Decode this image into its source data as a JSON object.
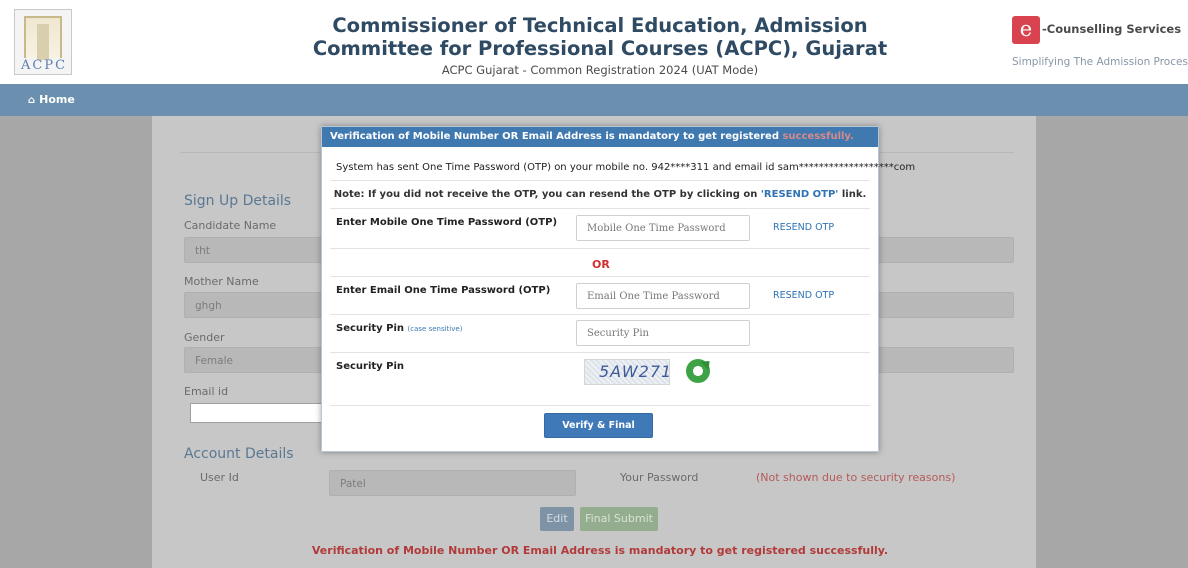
{
  "header": {
    "logo_text": "ACPC",
    "title_line1": "Commissioner of Technical Education, Admission",
    "title_line2": "Committee for Professional Courses (ACPC), Gujarat",
    "subtitle": "ACPC Gujarat - Common Registration 2024 (UAT Mode)",
    "ec_badge": "e",
    "ec_title": "-Counselling Services",
    "ec_tagline": "Simplifying The Admission Process"
  },
  "nav": {
    "home_label": "Home"
  },
  "form": {
    "signup_title": "Sign Up Details",
    "candidate_name_label": "Candidate Name",
    "candidate_name_value": "tht",
    "mother_name_label": "Mother Name",
    "mother_name_value": "ghgh",
    "gender_label": "Gender",
    "gender_value": "Female",
    "email_label": "Email id",
    "account_title": "Account Details",
    "user_id_label": "User Id",
    "user_id_value": "Patel",
    "password_label": "Your Password",
    "password_note": "(Not shown due to security reasons)",
    "edit_label": "Edit",
    "final_submit_label": "Final Submit",
    "bottom_warning": "Verification of Mobile Number OR Email Address is mandatory to get registered successfully."
  },
  "modal": {
    "header_text": "Verification of Mobile Number OR Email Address is mandatory to get registered ",
    "header_text_faded": "successfully.",
    "otp_sent_text": "System has sent One Time Password (OTP) on your mobile no. 942****311 and email id sam*******************com",
    "note_prefix": "Note: If you did not receive the OTP,    you can resend the OTP by clicking on ",
    "note_link": "'RESEND OTP'",
    "note_suffix": " link.",
    "mobile_otp_label": "Enter Mobile One Time Password (OTP)",
    "mobile_otp_placeholder": "Mobile One Time Password",
    "resend_label": "RESEND OTP",
    "or_label": "OR",
    "email_otp_label": "Enter Email One Time Password (OTP)",
    "email_otp_placeholder": "Email One Time Password",
    "security_pin_label": "Security Pin",
    "case_sensitive": "(case sensitive)",
    "security_pin_placeholder": "Security Pin",
    "captcha_label": "Security Pin",
    "captcha_text": "5AW271",
    "verify_button": "Verify & Final Submit"
  }
}
